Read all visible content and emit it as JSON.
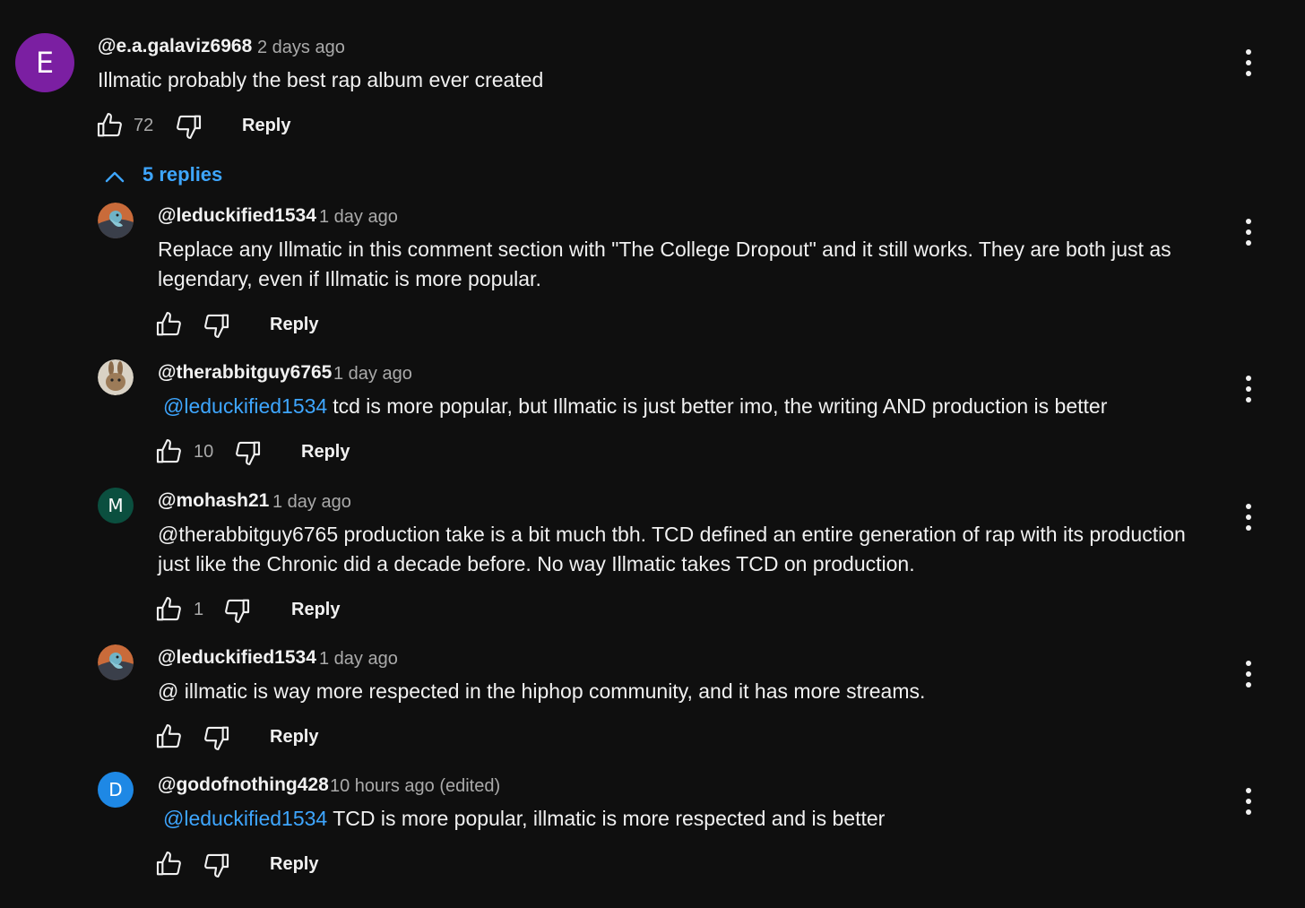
{
  "top_comment": {
    "avatar_letter": "E",
    "avatar_color": "#7b1fa2",
    "handle": "@e.a.galaviz6968",
    "time": "2 days ago",
    "text": "Illmatic probably the best rap album ever created",
    "likes": "72",
    "reply_label": "Reply",
    "replies_toggle": "5 replies"
  },
  "replies": [
    {
      "avatar": "duck-avatar",
      "handle": "@leduckified1534",
      "time": "1 day ago",
      "text": "Replace any Illmatic in this comment section with \"The College Dropout\" and it still works. They are both just as legendary, even if Illmatic is more popular.",
      "likes": "",
      "reply_label": "Reply"
    },
    {
      "avatar": "rabbit-avatar",
      "handle": "@therabbitguy6765",
      "time": "1 day ago",
      "mention": "@leduckified1534",
      "text": "tcd is more popular, but Illmatic is just better imo, the writing AND production is better",
      "likes": "10",
      "reply_label": "Reply"
    },
    {
      "avatar_letter": "M",
      "avatar_color": "#0b4f3f",
      "handle": "@mohash21",
      "time": "1 day ago",
      "text": "@therabbitguy6765 production take is a bit much tbh. TCD defined an entire generation of rap with its production just like the Chronic did a decade before. No way Illmatic takes TCD on production.",
      "likes": "1",
      "reply_label": "Reply"
    },
    {
      "avatar": "duck-avatar",
      "handle": "@leduckified1534",
      "time": "1 day ago",
      "text": "@ illmatic is way more respected in the hiphop community, and it has more streams.",
      "likes": "",
      "reply_label": "Reply"
    },
    {
      "avatar_letter": "D",
      "avatar_color": "#1e88e5",
      "handle": "@godofnothing428",
      "time": "10 hours ago (edited)",
      "mention": "@leduckified1534",
      "text": "TCD is more popular, illmatic is more respected and is better",
      "likes": "",
      "reply_label": "Reply"
    }
  ],
  "colors": {
    "background": "#0f0f0f",
    "link": "#3ea6ff",
    "secondary_text": "#aaaaaa"
  },
  "icons": [
    "thumb-up-icon",
    "thumb-down-icon",
    "more-vert-icon",
    "chevron-up-icon"
  ]
}
